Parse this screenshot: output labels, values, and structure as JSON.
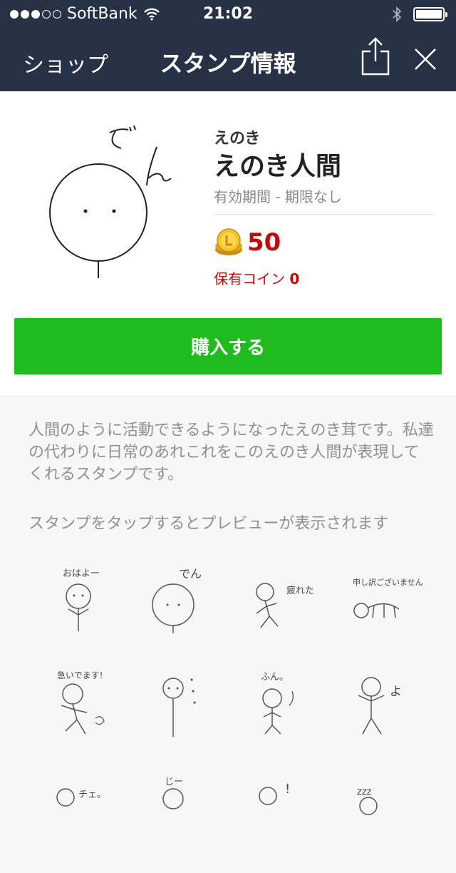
{
  "status_bar": {
    "carrier": "SoftBank",
    "time": "21:02",
    "signal_bars": 3,
    "signal_total": 5
  },
  "nav": {
    "back_label": "ショップ",
    "title": "スタンプ情報"
  },
  "sticker": {
    "main_art_text": "でん",
    "author": "えのき",
    "title": "えのき人間",
    "period": "有効期間 - 期限なし",
    "price": "50",
    "owned_label": "保有コイン",
    "owned_value": "0"
  },
  "buy_button": {
    "label": "購入する"
  },
  "description": "人間のように活動できるようになったえのき茸です。私達の代わりに日常のあれこれをこのえのき人間が表現してくれるスタンプです。",
  "preview_hint": "スタンプをタップするとプレビューが表示されます",
  "stamps": [
    {
      "text": "おはよー"
    },
    {
      "text": "でん"
    },
    {
      "text": "疲れた"
    },
    {
      "text": "申し訳ございません"
    },
    {
      "text": "急いでます!"
    },
    {
      "text": ""
    },
    {
      "text": "ふん。"
    },
    {
      "text": "よ"
    },
    {
      "text": "チェ。"
    },
    {
      "text": "じー"
    },
    {
      "text": "!"
    },
    {
      "text": "zzz"
    }
  ]
}
